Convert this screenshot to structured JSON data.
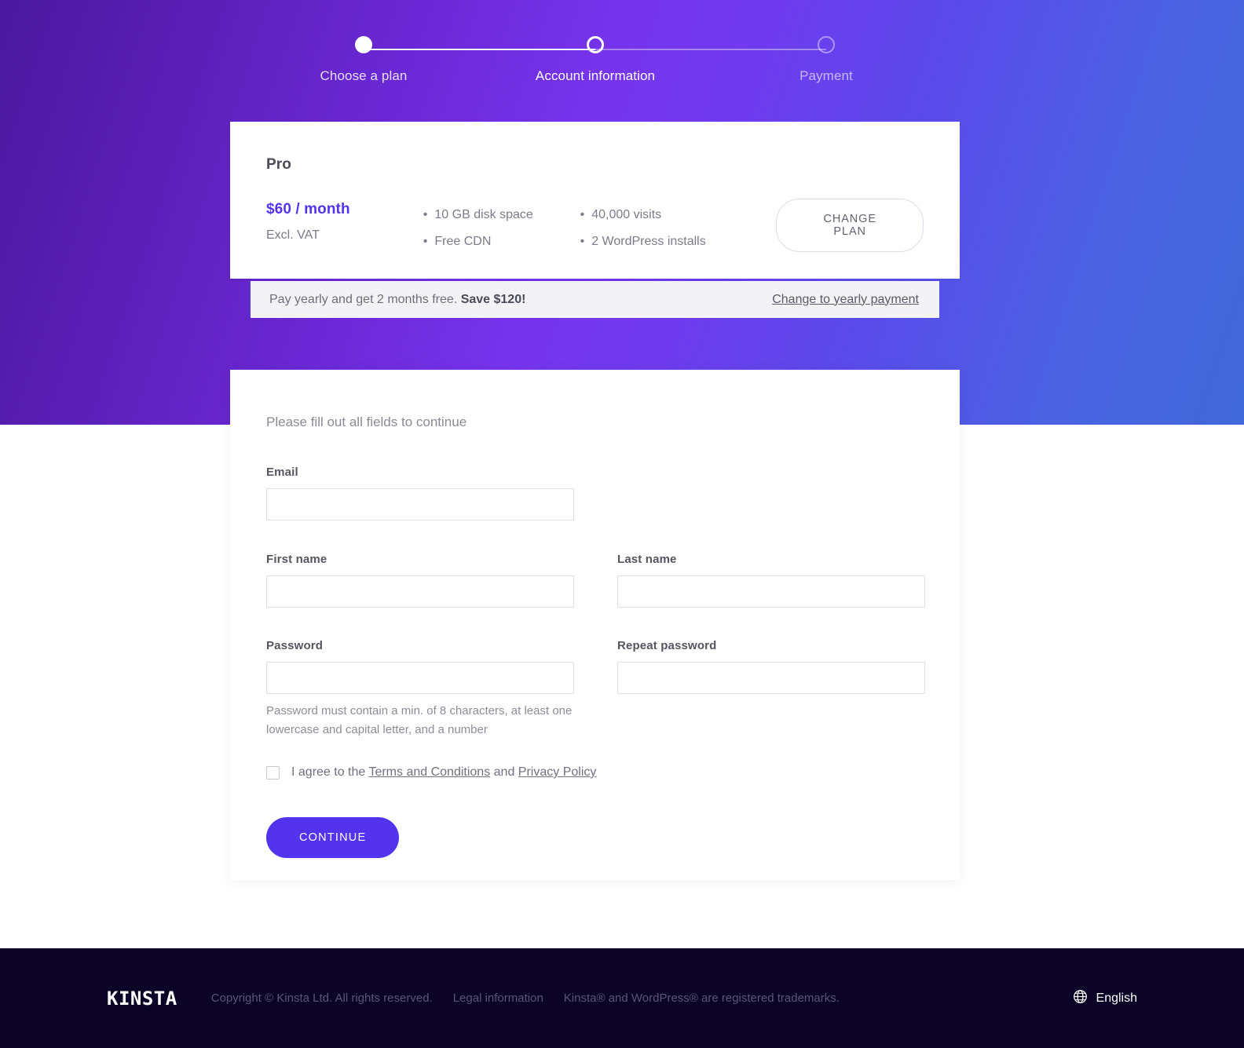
{
  "stepper": {
    "steps": [
      {
        "label": "Choose a plan",
        "state": "completed"
      },
      {
        "label": "Account information",
        "state": "current"
      },
      {
        "label": "Payment",
        "state": "upcoming"
      }
    ]
  },
  "plan": {
    "title": "Pro",
    "price": "$60 / month",
    "vat_note": "Excl. VAT",
    "features_col1": [
      "10 GB disk space",
      "Free CDN"
    ],
    "features_col2": [
      "40,000 visits",
      "2 WordPress installs"
    ],
    "bullet": "•",
    "change_plan_label": "CHANGE PLAN"
  },
  "yearly_banner": {
    "text_prefix": "Pay yearly and get 2 months free. ",
    "text_bold": "Save $120!",
    "link_label": "Change to yearly payment"
  },
  "form": {
    "intro": "Please fill out all fields to continue",
    "email": {
      "label": "Email",
      "value": "",
      "placeholder": ""
    },
    "first_name": {
      "label": "First name",
      "value": "",
      "placeholder": ""
    },
    "last_name": {
      "label": "Last name",
      "value": "",
      "placeholder": ""
    },
    "password": {
      "label": "Password",
      "value": "",
      "placeholder": ""
    },
    "repeat_password": {
      "label": "Repeat password",
      "value": "",
      "placeholder": ""
    },
    "password_hint": "Password must contain a min. of 8 characters, at least one lowercase and capital letter, and a number",
    "terms": {
      "text_before": "I agree to the ",
      "terms_link": "Terms and Conditions",
      "text_between": " and ",
      "privacy_link": "Privacy Policy",
      "checked": false
    },
    "continue_label": "CONTINUE"
  },
  "footer": {
    "logo": "KINSTA",
    "copyright": "Copyright © Kinsta Ltd. All rights reserved.",
    "legal_link": "Legal information",
    "trademarks": "Kinsta® and WordPress® are registered trademarks.",
    "language": "English"
  },
  "colors": {
    "accent": "#5333ee",
    "price": "#5533ee",
    "gradient_start": "#4a189f",
    "gradient_mid": "#7634ee",
    "gradient_end": "#4068d8",
    "footer_bg": "#0b0427",
    "banner_bg": "#f3f3f6",
    "banner_border": "#5b2fd6"
  }
}
